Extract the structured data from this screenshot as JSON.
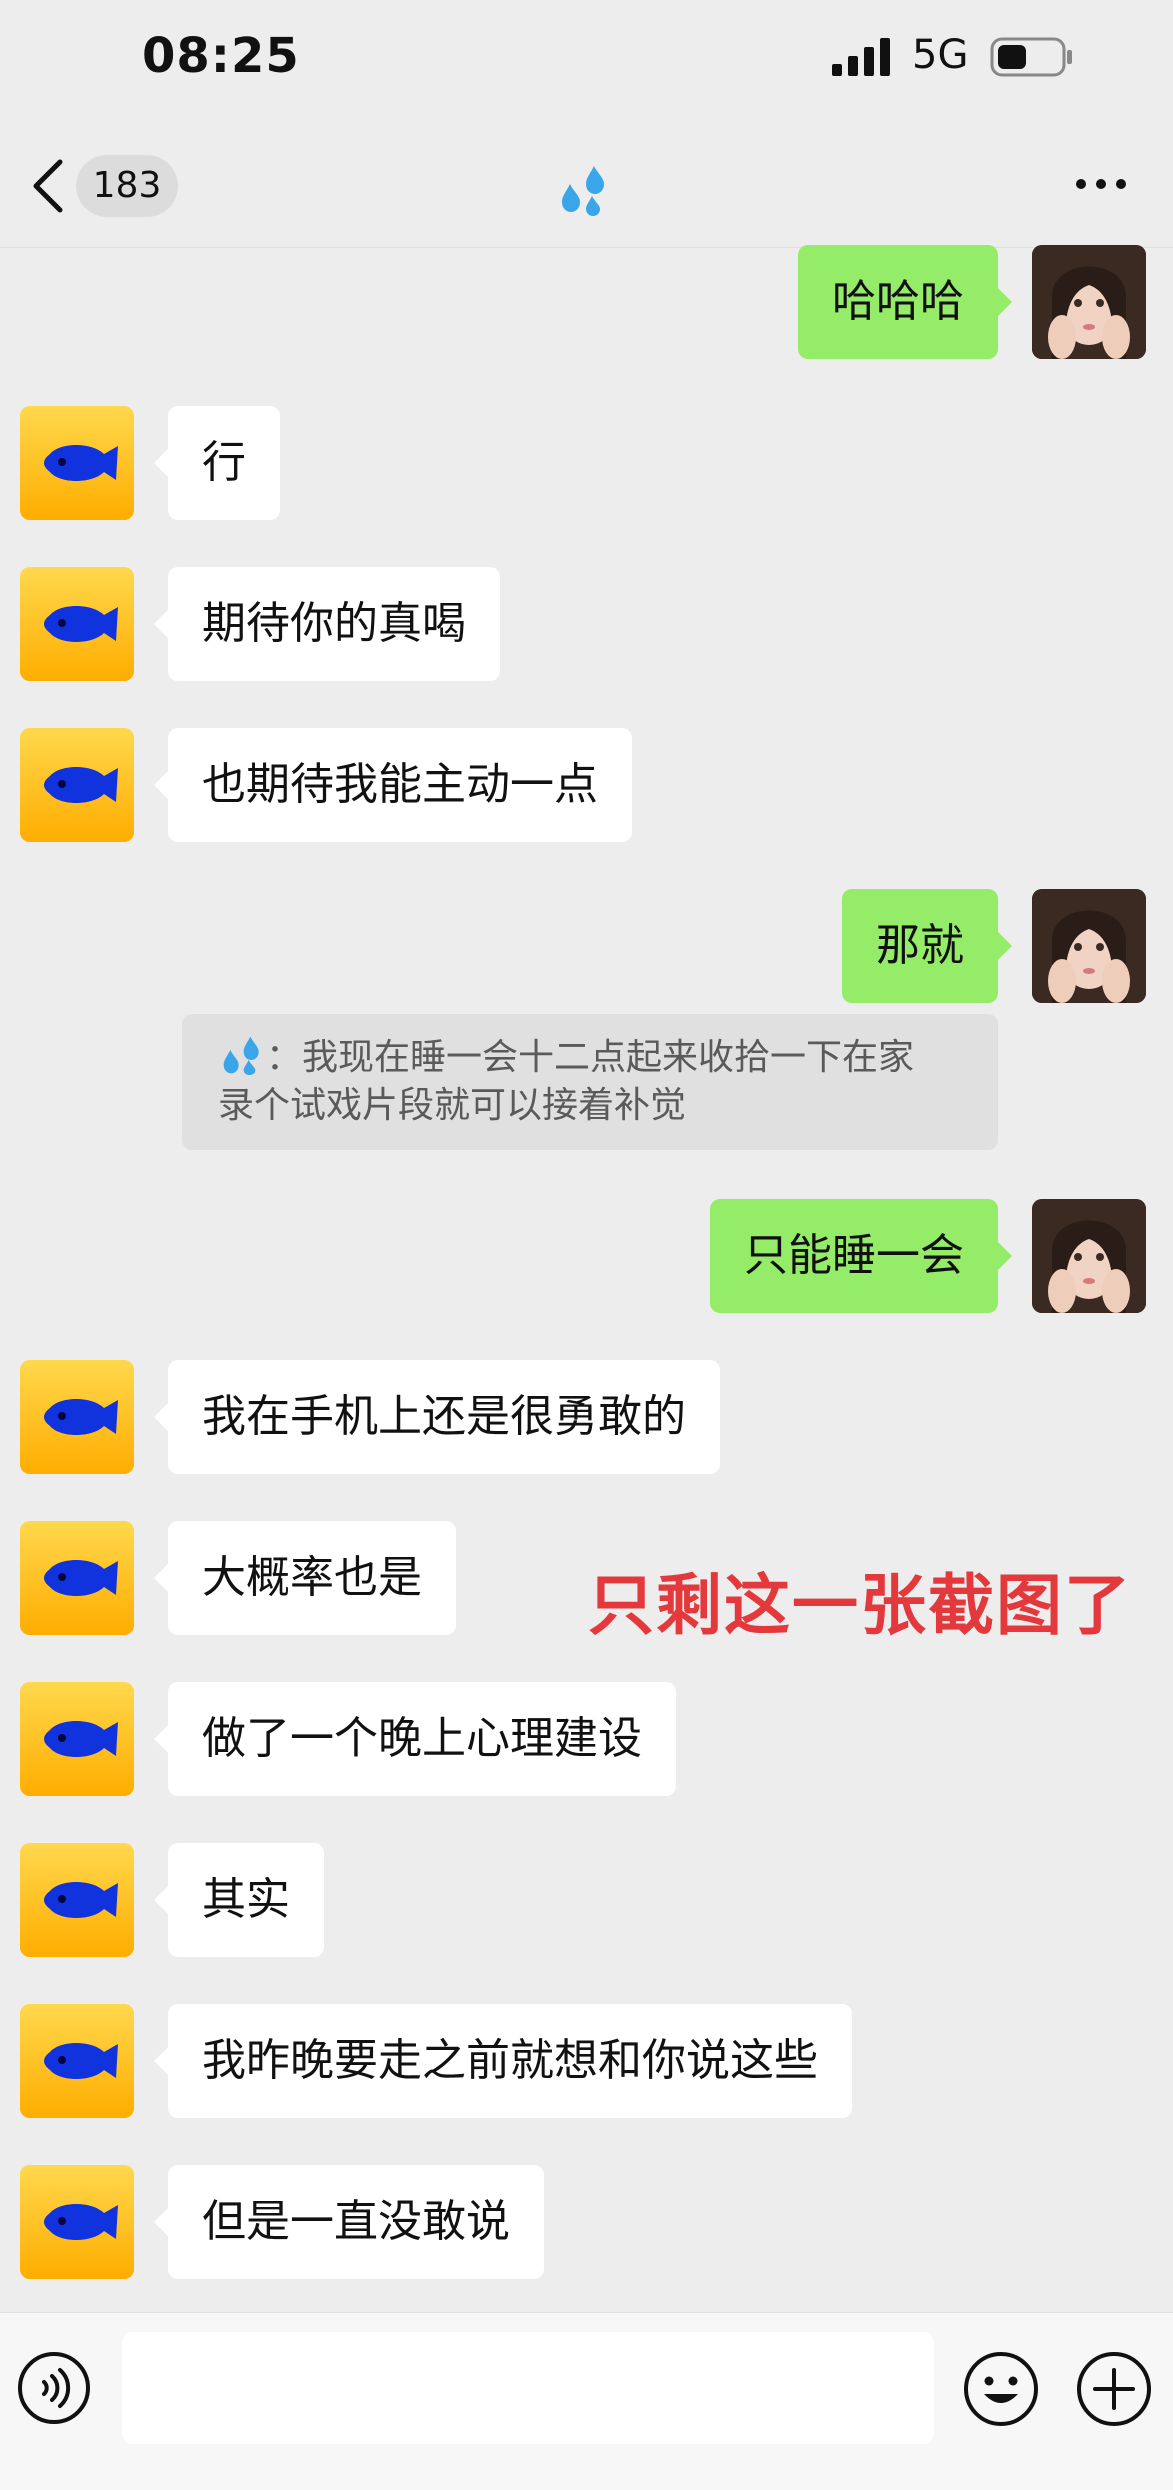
{
  "status_bar": {
    "time": "08:25",
    "network": "5G",
    "icons": [
      "signal-icon",
      "battery-icon"
    ]
  },
  "nav": {
    "unread_count": "183",
    "title_icon": "sweat-droplets-icon",
    "more_icon": "more-icon",
    "back_icon": "back-icon"
  },
  "messages": [
    {
      "side": "out",
      "text": "哈哈哈"
    },
    {
      "side": "in",
      "text": "行"
    },
    {
      "side": "in",
      "text": "期待你的真喝"
    },
    {
      "side": "in",
      "text": "也期待我能主动一点"
    },
    {
      "side": "out",
      "text": "那就"
    },
    {
      "side": "out",
      "text": "只能睡一会"
    },
    {
      "side": "in",
      "text": "我在手机上还是很勇敢的"
    },
    {
      "side": "in",
      "text": "大概率也是"
    },
    {
      "side": "in",
      "text": "做了一个晚上心理建设"
    },
    {
      "side": "in",
      "text": "其实"
    },
    {
      "side": "in",
      "text": "我昨晚要走之前就想和你说这些"
    },
    {
      "side": "in",
      "text": "但是一直没敢说"
    }
  ],
  "quote": {
    "icon": "sweat-droplets-icon",
    "prefix": "：",
    "text_line1": "我现在睡一会十二点起来收拾一下在家",
    "text_line2": "录个试戏片段就可以接着补觉"
  },
  "overlay_caption": "只剩这一张截图了",
  "input_bar": {
    "icons": [
      "voice-icon",
      "emoji-icon",
      "plus-icon"
    ],
    "value": ""
  },
  "colors": {
    "background": "#ededed",
    "outgoing_bubble": "#95ec69",
    "incoming_bubble": "#ffffff",
    "overlay_text": "#e3393c"
  }
}
